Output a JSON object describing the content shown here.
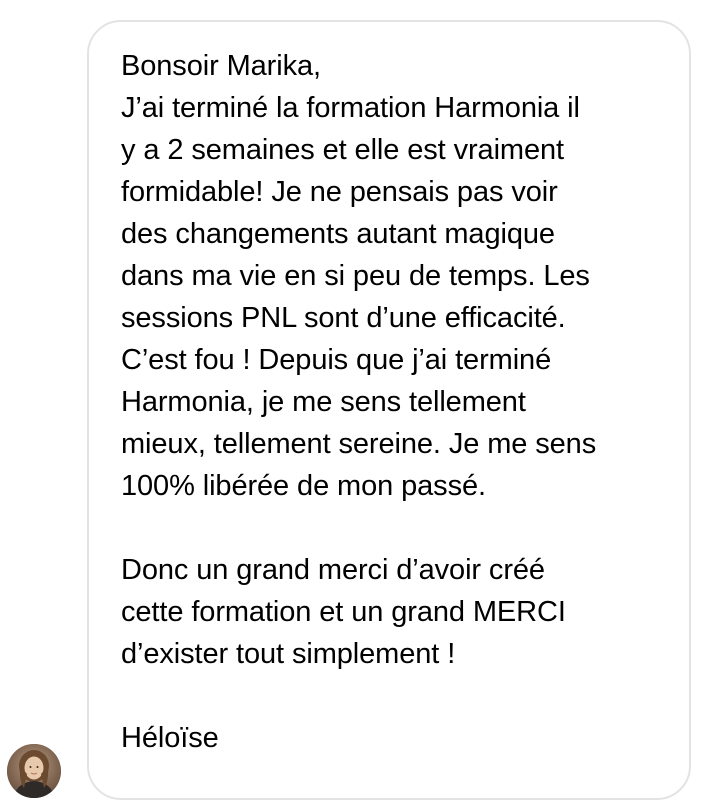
{
  "message": {
    "greeting": "Bonsoir Marika,",
    "paragraph1_lines": [
      "J’ai terminé la formation Harmonia il",
      "y a 2 semaines et elle est vraiment",
      "formidable! Je ne pensais pas voir",
      "des changements autant magique",
      "dans ma vie en si peu de temps. Les",
      "sessions PNL sont d’une efficacité.",
      "C’est fou ! Depuis que j’ai terminé",
      "Harmonia, je me sens tellement",
      "mieux, tellement sereine. Je me sens",
      "100% libérée de mon passé."
    ],
    "paragraph2_lines": [
      "Donc un grand merci d’avoir créé",
      "cette formation et un grand MERCI",
      "d’exister tout simplement !"
    ],
    "signature": "Héloïse"
  },
  "avatar": {
    "icon": "user-photo-avatar"
  },
  "colors": {
    "bubble_border": "#e3e3e3",
    "text": "#000000",
    "background": "#ffffff"
  }
}
